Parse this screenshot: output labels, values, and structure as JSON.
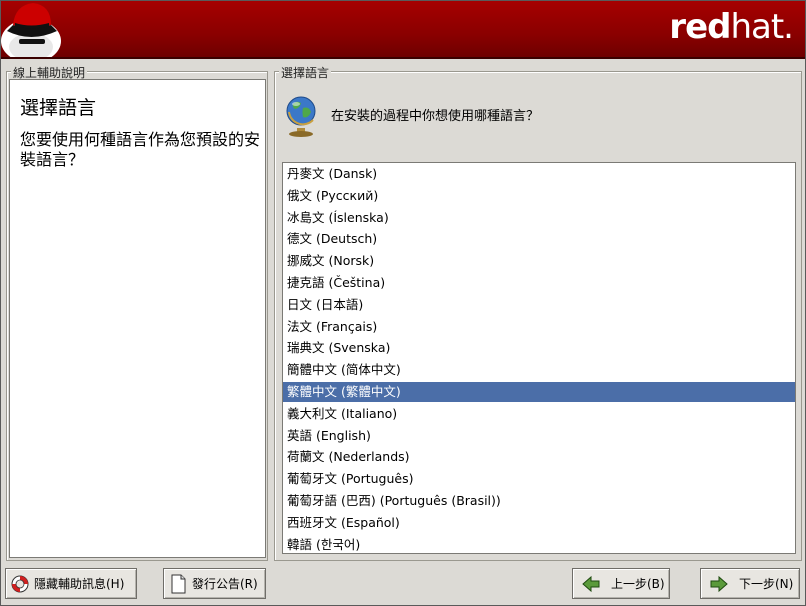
{
  "header": {
    "brand_bold": "red",
    "brand_light": "hat."
  },
  "help": {
    "frame_label": "線上輔助說明",
    "title": "選擇語言",
    "body": "您要使用何種語言作為您預設的安裝語言？"
  },
  "language": {
    "frame_label": "選擇語言",
    "prompt": "在安裝的過程中你想使用哪種語言？",
    "items": [
      "丹麥文 (Dansk)",
      "俄文 (Русский)",
      "冰島文 (Íslenska)",
      "德文 (Deutsch)",
      "挪威文 (Norsk)",
      "捷克語 (Čeština)",
      "日文 (日本語)",
      "法文 (Français)",
      "瑞典文 (Svenska)",
      "簡體中文 (简体中文)",
      "繁體中文 (繁體中文)",
      "義大利文 (Italiano)",
      "英語 (English)",
      "荷蘭文 (Nederlands)",
      "葡萄牙文 (Português)",
      "葡萄牙語 (巴西) (Português (Brasil))",
      "西班牙文 (Español)",
      "韓語 (한국어)"
    ],
    "selected": "繁體中文 (繁體中文)"
  },
  "buttons": {
    "hide_help": "隱藏輔助訊息(H)",
    "release_notes": "發行公告(R)",
    "back": "上一步(B)",
    "next": "下一步(N)"
  },
  "icons": {
    "hide_help": "lifebuoy-icon",
    "release_notes": "document-icon",
    "back": "arrow-left-icon",
    "next": "arrow-right-icon",
    "prompt": "globe-icon",
    "logo": "shadowman-logo"
  },
  "colors": {
    "banner": "#8a0000",
    "selection": "#4b6ea8",
    "background": "#dcdad5"
  }
}
